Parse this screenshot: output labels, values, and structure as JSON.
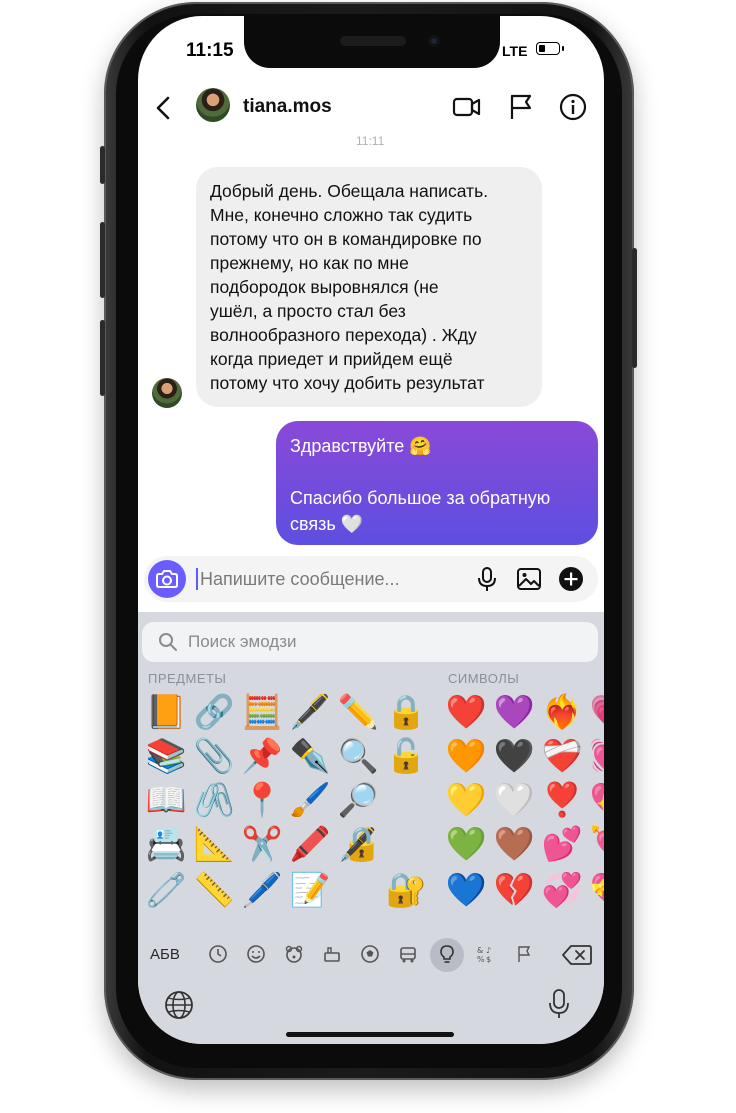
{
  "status": {
    "time": "11:15",
    "network": "LTE",
    "battery_level": 0.35
  },
  "header": {
    "username": "tiana.mos",
    "timestamp_partial": "11:11"
  },
  "messages": {
    "incoming_text": "Добрый день. Обещала написать.\nМне, конечно сложно так судить\nпотому что он в командировке по\nпрежнему, но как по мне\nподбородок выровнялся (не\nушёл, а просто стал без\nволнообразного перехода) . Жду\nкогда приедет и прийдем ещё\nпотому что хочу добить результат",
    "outgoing_line1": "Здравствуйте 🤗",
    "outgoing_line2": "Спасибо большое за обратную связь 🤍",
    "outgoing_gradient": [
      "#8a49d8",
      "#5d4fe0"
    ]
  },
  "composer": {
    "placeholder": "Напишите сообщение..."
  },
  "keyboard": {
    "search_placeholder": "Поиск эмодзи",
    "category_objects": "ПРЕДМЕТЫ",
    "category_symbols": "СИМВОЛЫ",
    "abc_label": "АБВ",
    "objects_columns": [
      [
        "📙",
        "📚",
        "📖",
        "📇",
        "🧷"
      ],
      [
        "🔗",
        "📎",
        "🖇️",
        "📐",
        "📏"
      ],
      [
        "🧮",
        "📌",
        "📍",
        "✂️",
        "🖊️"
      ],
      [
        "🖋️",
        "✒️",
        "🖌️",
        "🖍️",
        "📝"
      ],
      [
        "✏️",
        "🔍",
        "🔎",
        "🔏",
        ""
      ],
      [
        "🔒",
        "🔓",
        "",
        "",
        "🔐"
      ]
    ],
    "symbols_columns": [
      [
        "❤️",
        "🧡",
        "💛",
        "💚",
        "💙"
      ],
      [
        "💜",
        "🖤",
        "🤍",
        "🤎",
        "💔"
      ],
      [
        "❤️‍🔥",
        "❤️‍🩹",
        "❣️",
        "💕",
        "💞"
      ],
      [
        "💗",
        "💓",
        "💖",
        "💘",
        "💝"
      ]
    ]
  }
}
